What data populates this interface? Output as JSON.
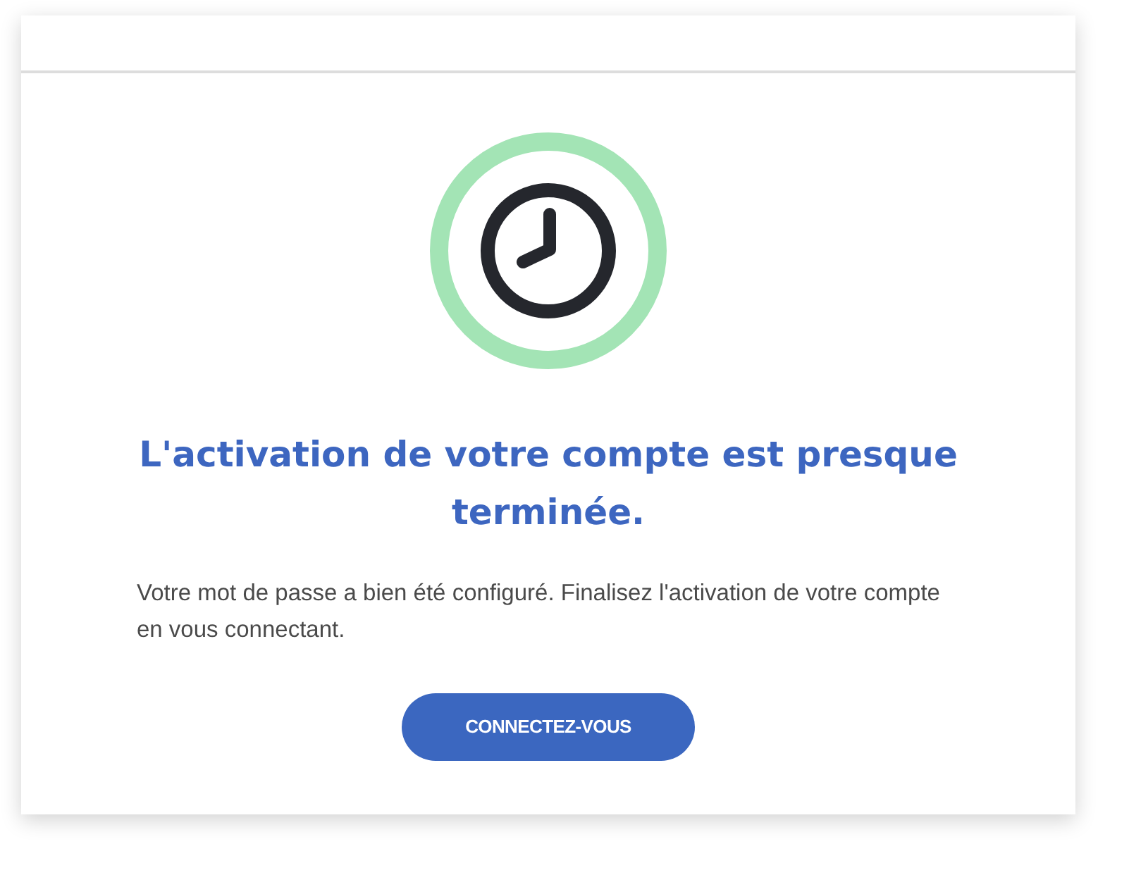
{
  "title": "L'activation de votre compte est presque terminée.",
  "message": "Votre mot de passe a bien été configuré. Finalisez l'activation de votre compte en vous connectant.",
  "button": {
    "label": "CONNECTEZ-VOUS"
  }
}
